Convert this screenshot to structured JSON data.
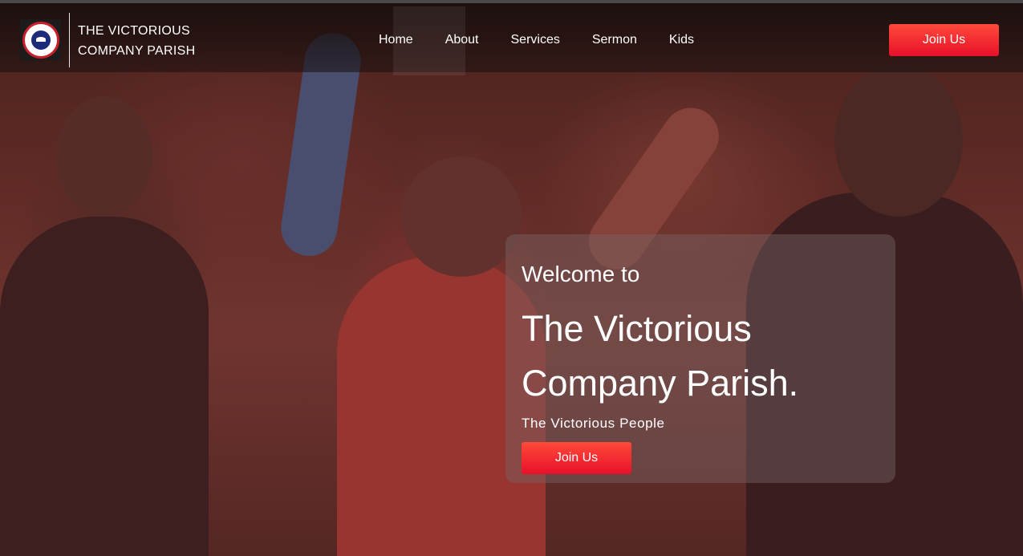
{
  "brand": {
    "line1": "THE VICTORIOUS",
    "line2": "COMPANY PARISH",
    "logo_icon": "church-seal-icon"
  },
  "nav": {
    "items": [
      {
        "label": "Home"
      },
      {
        "label": "About"
      },
      {
        "label": "Services"
      },
      {
        "label": "Sermon"
      },
      {
        "label": "Kids"
      }
    ],
    "join_label": "Join Us"
  },
  "hero": {
    "welcome": "Welcome to",
    "title_line1": "The Victorious",
    "title_line2": "Company Parish.",
    "tagline": "The Victorious People",
    "join_label": "Join Us"
  },
  "colors": {
    "accent": "#ff1f2f",
    "nav_text": "#ffffff"
  }
}
